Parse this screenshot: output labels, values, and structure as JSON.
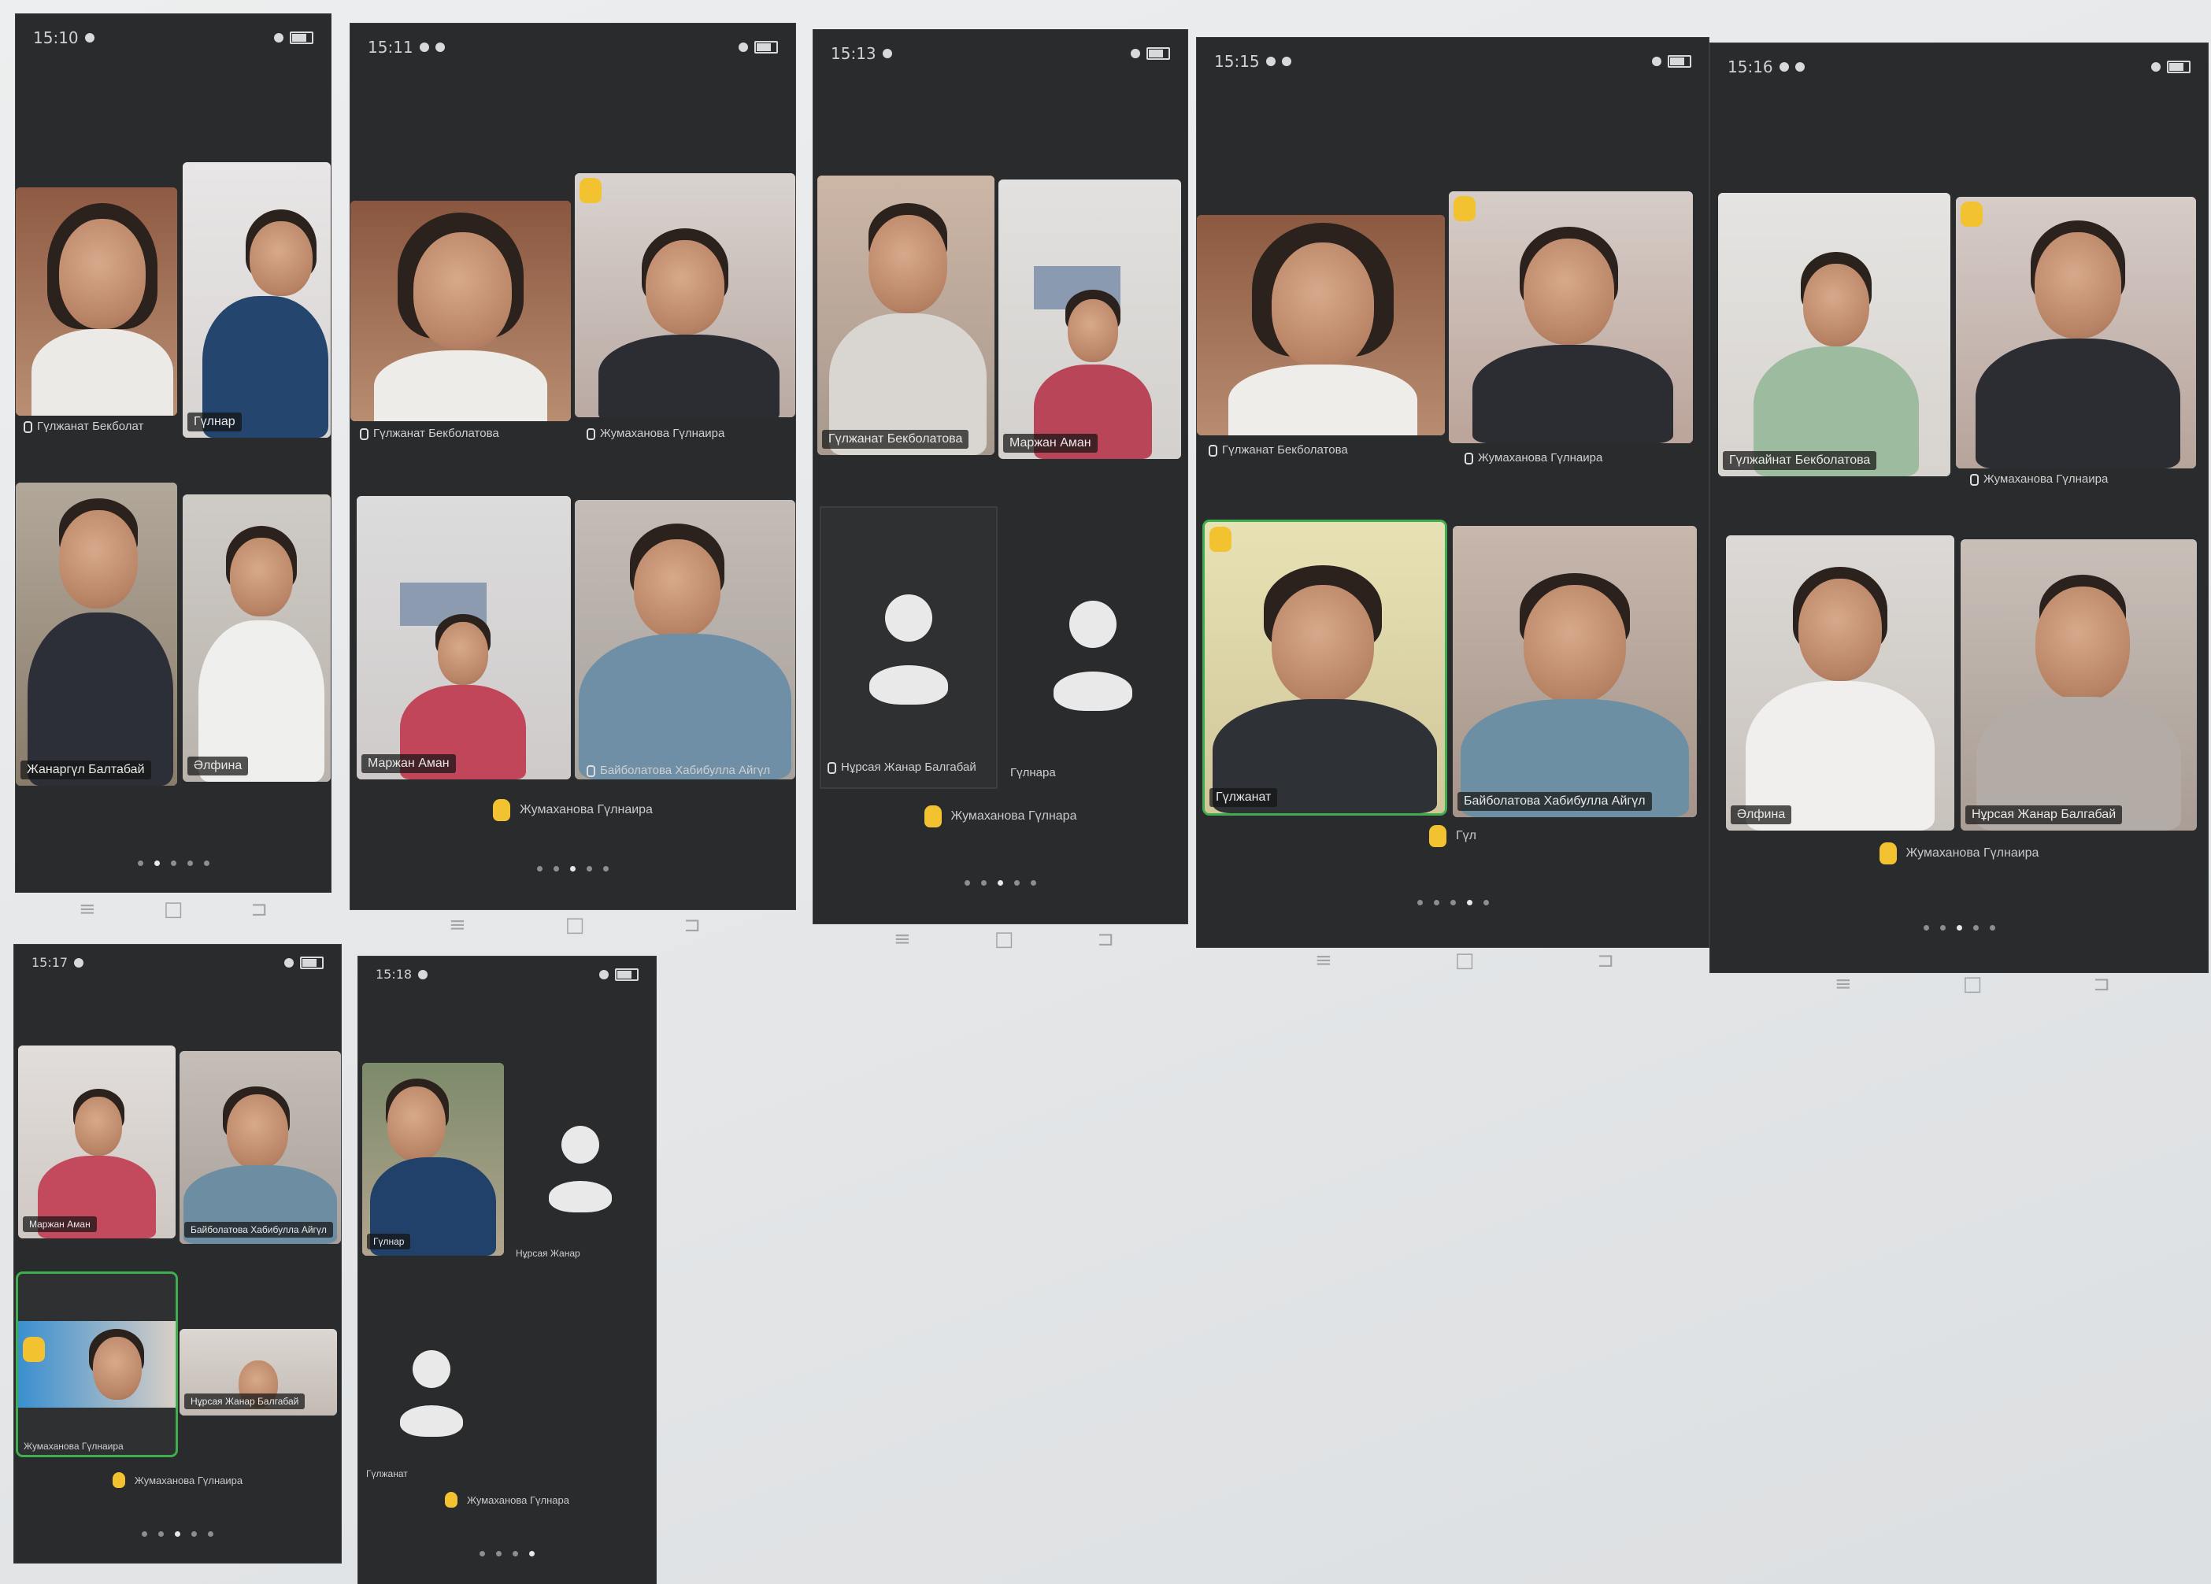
{
  "status_time": "15:10",
  "phones": [
    {
      "id": "p1",
      "status_time": "15:10",
      "tiles": [
        {
          "name": "Гүлжанат Бекболат",
          "label_style": "under"
        },
        {
          "name": "Гүлнар",
          "label_style": "tag"
        },
        {
          "name": "Жанаргүл Балтабай",
          "label_style": "under"
        },
        {
          "name": "Әлфина",
          "label_style": "tag"
        }
      ],
      "raised_hand_name": ""
    },
    {
      "id": "p2",
      "status_time": "15:11",
      "tiles": [
        {
          "name": "Гүлжанат Бекболатова",
          "label_style": "under"
        },
        {
          "name": "Жумаханова Гүлнаира",
          "label_style": "under"
        },
        {
          "name": "Маржан Аман",
          "label_style": "tag"
        },
        {
          "name": "Байболатова Хабибулла Айгүл",
          "label_style": "under"
        }
      ],
      "raised_hand_name": "Жумаханова Гүлнаира"
    },
    {
      "id": "p3",
      "status_time": "15:13",
      "tiles": [
        {
          "name": "Гүлжанат Бекболатова",
          "label_style": "tag"
        },
        {
          "name": "Маржан Аман",
          "label_style": "tag"
        },
        {
          "name": "Нұрсая Жанар Балгабай",
          "label_style": "under"
        },
        {
          "name": "Гүлнара",
          "label_style": "under"
        }
      ],
      "raised_hand_name": "Жумаханова Гүлнара"
    },
    {
      "id": "p4",
      "status_time": "15:15",
      "tiles": [
        {
          "name": "Гүлжанат Бекболатова",
          "label_style": "under"
        },
        {
          "name": "Жумаханова Гүлнаира",
          "label_style": "under"
        },
        {
          "name": "Гүлжанат",
          "label_style": "under"
        },
        {
          "name": "Байболатова Хабибулла Айгүл",
          "label_style": "tag"
        }
      ],
      "raised_hand_name": "Гүл"
    },
    {
      "id": "p5",
      "status_time": "15:16",
      "tiles": [
        {
          "name": "Гүлжайнат Бекболатова",
          "label_style": "tag"
        },
        {
          "name": "Жумаханова Гүлнаира",
          "label_style": "under"
        },
        {
          "name": "Әлфина",
          "label_style": "tag"
        },
        {
          "name": "Нұрсая Жанар Балгабай",
          "label_style": "tag"
        }
      ],
      "raised_hand_name": "Жумаханова Гүлнаира"
    },
    {
      "id": "p6",
      "status_time": "15:17",
      "tiles": [
        {
          "name": "Маржан Аман",
          "label_style": "tag"
        },
        {
          "name": "Байболатова Хабибулла Айгүл",
          "label_style": "tag"
        },
        {
          "name": "Жумаханова Гүлнаира",
          "label_style": "under"
        },
        {
          "name": "Нұрсая Жанар Балгабай",
          "label_style": "tag"
        }
      ],
      "raised_hand_name": "Жумаханова Гүлнаира"
    },
    {
      "id": "p7",
      "status_time": "15:18",
      "tiles": [
        {
          "name": "Гүлнар",
          "label_style": "tag"
        },
        {
          "name": "Нұрсая Жанар",
          "label_style": "under"
        },
        {
          "name": "Гүлжанат",
          "label_style": "under"
        }
      ],
      "raised_hand_name": "Жумаханова Гүлнара"
    }
  ],
  "icons": {
    "mic": "mic-icon",
    "raise_hand": "raise-hand-icon",
    "avatar": "person-avatar-icon",
    "nav_menu": "menu-icon",
    "nav_home": "home-icon",
    "nav_back": "back-icon"
  },
  "colors": {
    "phone_bg": "#2a2b2c",
    "active_speaker": "#3fae4f",
    "raise_hand": "#f2c230",
    "paper": "#e6e8e9"
  }
}
